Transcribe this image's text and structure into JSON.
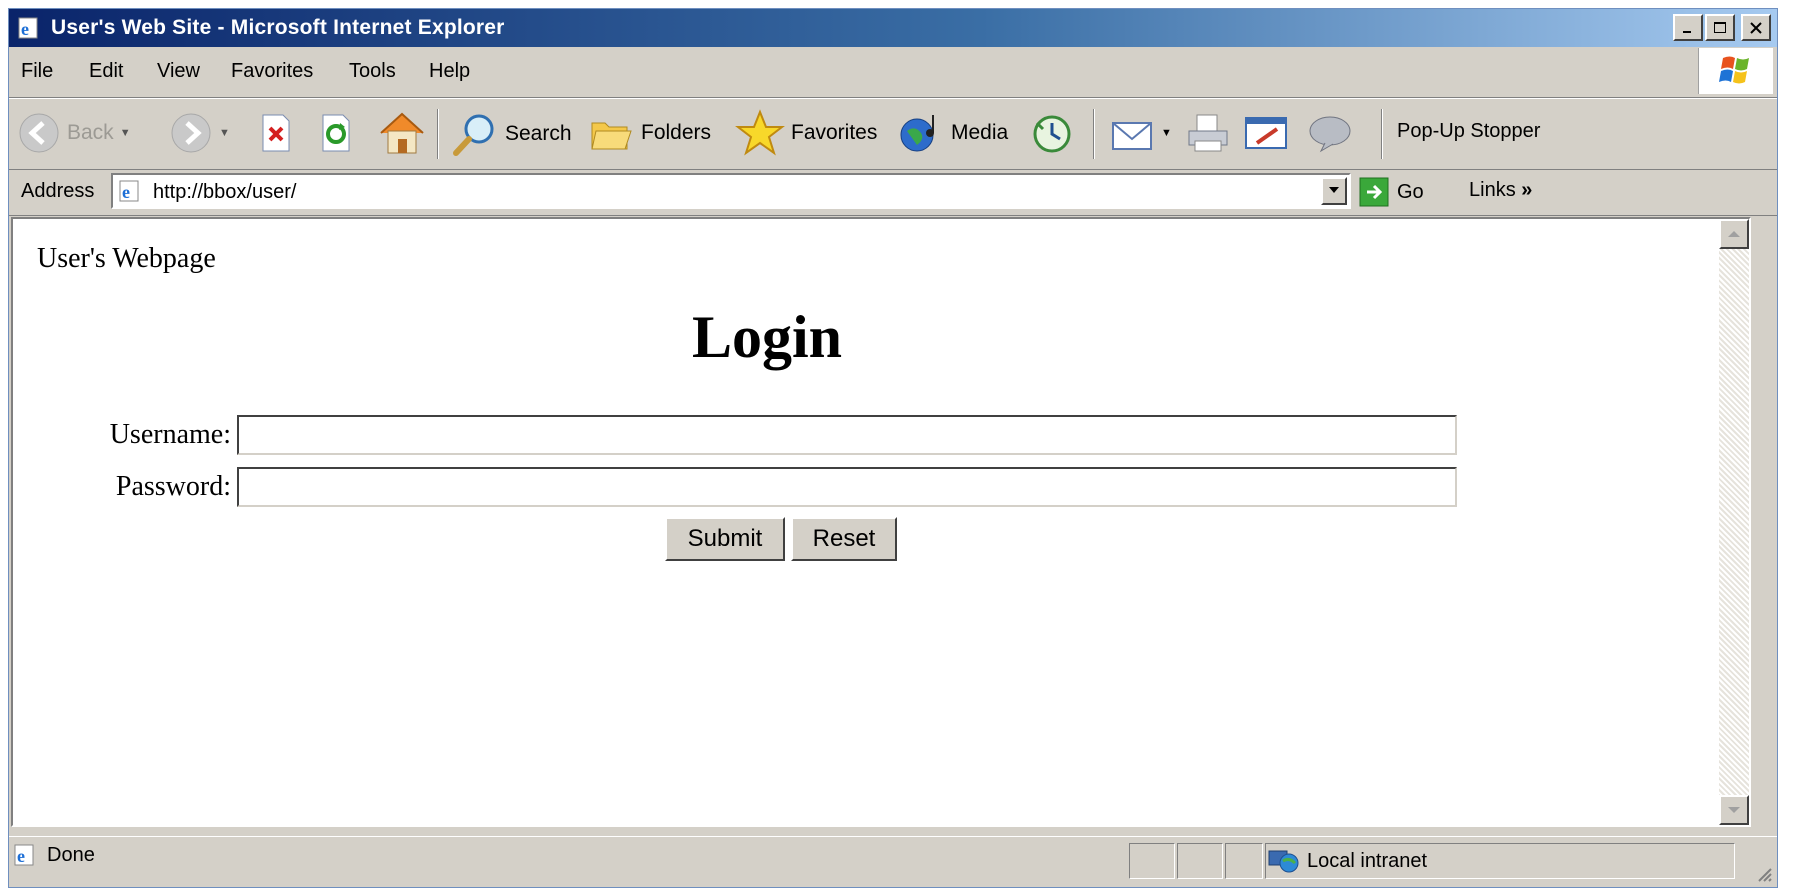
{
  "window": {
    "title": "User's Web Site - Microsoft Internet Explorer"
  },
  "menu": {
    "items": [
      "File",
      "Edit",
      "View",
      "Favorites",
      "Tools",
      "Help"
    ]
  },
  "toolbar": {
    "back_label": "Back",
    "search_label": "Search",
    "folders_label": "Folders",
    "favorites_label": "Favorites",
    "media_label": "Media",
    "popup_stopper_label": "Pop-Up Stopper"
  },
  "address_bar": {
    "label": "Address",
    "url": "http://bbox/user/",
    "go_label": "Go",
    "links_label": "Links"
  },
  "page": {
    "site_label": "User's Webpage",
    "heading": "Login",
    "username_label": "Username:",
    "username_value": "",
    "password_label": "Password:",
    "password_value": "",
    "submit_label": "Submit",
    "reset_label": "Reset"
  },
  "status_bar": {
    "status_text": "Done",
    "zone_text": "Local intranet"
  }
}
